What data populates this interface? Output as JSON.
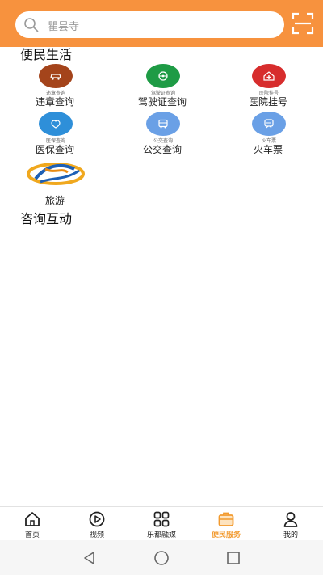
{
  "search": {
    "placeholder": "瞿昙寺"
  },
  "sections": {
    "life": "便民生活",
    "consult": "咨询互动"
  },
  "services": [
    {
      "label": "违章查询",
      "mini": "违章查询",
      "color": "#a4441b"
    },
    {
      "label": "驾驶证查询",
      "mini": "驾驶证查询",
      "color": "#1e9b45"
    },
    {
      "label": "医院挂号",
      "mini": "医院挂号",
      "color": "#d72d2d"
    },
    {
      "label": "医保查询",
      "mini": "医保查询",
      "color": "#2e8fd9"
    },
    {
      "label": "公交查询",
      "mini": "公交查询",
      "color": "#6aa0e6"
    },
    {
      "label": "火车票",
      "mini": "火车票",
      "color": "#6aa0e6"
    },
    {
      "label": "旅游"
    }
  ],
  "tabs": [
    {
      "label": "首页",
      "icon": "home-icon"
    },
    {
      "label": "视频",
      "icon": "play-icon"
    },
    {
      "label": "乐都融媒",
      "icon": "grid-icon"
    },
    {
      "label": "便民服务",
      "icon": "briefcase-icon",
      "active": true
    },
    {
      "label": "我的",
      "icon": "user-icon"
    }
  ],
  "colors": {
    "header": "#f7923e",
    "active_tab": "#f29a2e"
  }
}
